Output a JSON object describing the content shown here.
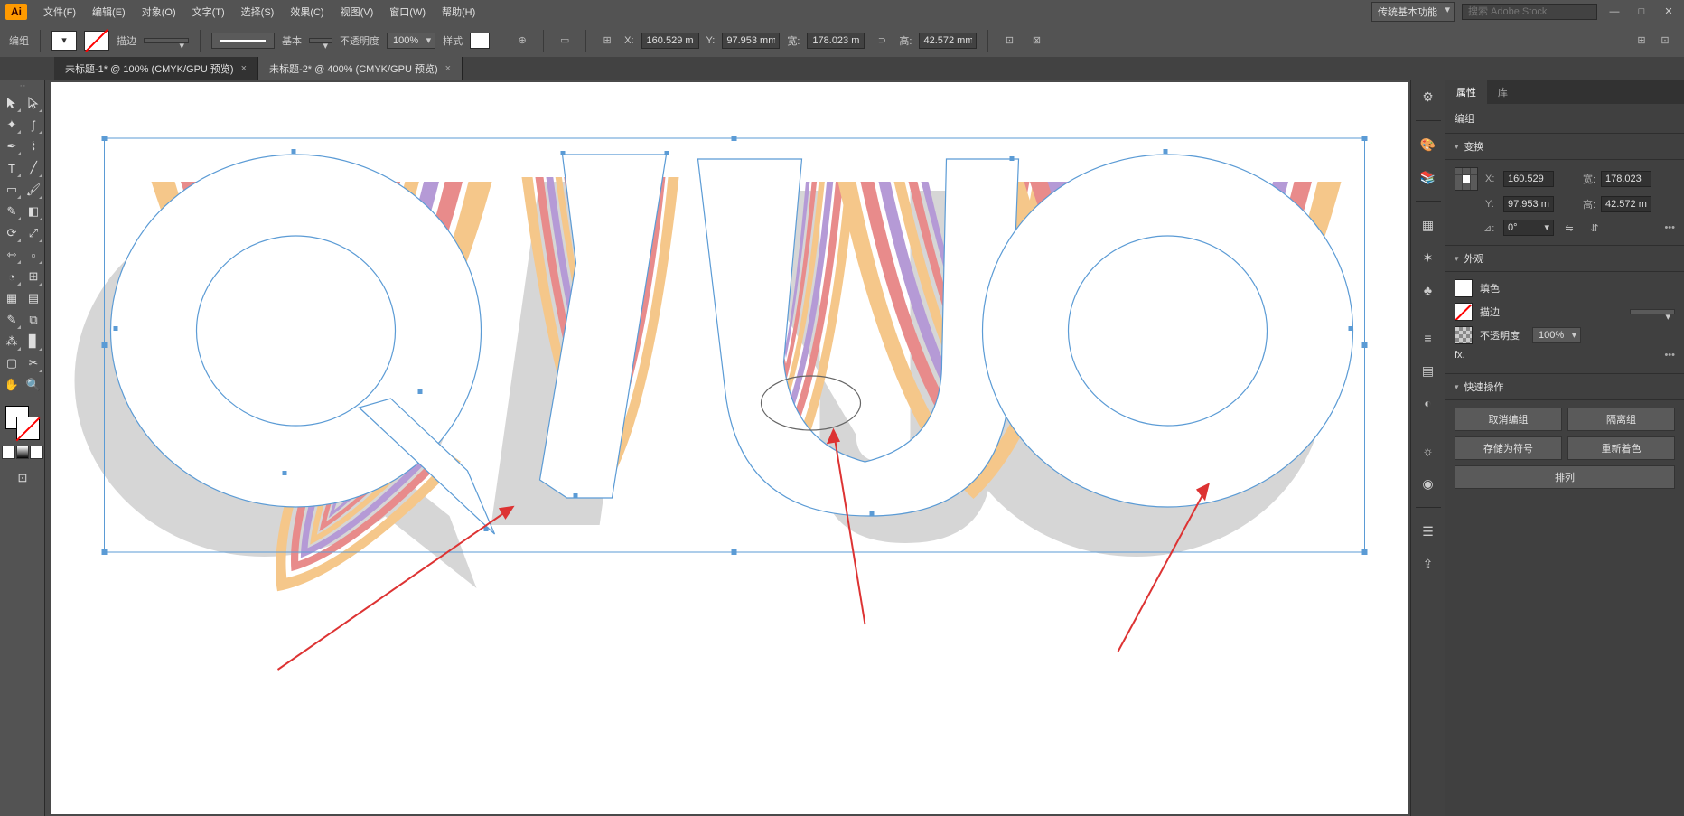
{
  "menubar": {
    "items": [
      "文件(F)",
      "编辑(E)",
      "对象(O)",
      "文字(T)",
      "选择(S)",
      "效果(C)",
      "视图(V)",
      "窗口(W)",
      "帮助(H)"
    ],
    "workspace": "传统基本功能",
    "search_placeholder": "搜索 Adobe Stock"
  },
  "controlbar": {
    "object_type": "编组",
    "stroke_label": "描边",
    "stroke_weight": "",
    "stroke_style_label": "基本",
    "opacity_label": "不透明度",
    "opacity_value": "100%",
    "style_label": "样式",
    "x_label": "X:",
    "x_value": "160.529 m",
    "y_label": "Y:",
    "y_value": "97.953 mm",
    "w_label": "宽:",
    "w_value": "178.023 m",
    "h_label": "高:",
    "h_value": "42.572 mm"
  },
  "tabs": [
    {
      "label": "未标题-1* @ 100% (CMYK/GPU 预览)",
      "active": false
    },
    {
      "label": "未标题-2* @ 400% (CMYK/GPU 预览)",
      "active": true
    }
  ],
  "tools": [
    {
      "name": "selection",
      "glyph": "▲"
    },
    {
      "name": "direct-selection",
      "glyph": "▲"
    },
    {
      "name": "magic-wand",
      "glyph": "✦"
    },
    {
      "name": "lasso",
      "glyph": "ʃ"
    },
    {
      "name": "pen",
      "glyph": "✒"
    },
    {
      "name": "curvature",
      "glyph": "⌇"
    },
    {
      "name": "type",
      "glyph": "T"
    },
    {
      "name": "line-segment",
      "glyph": "╱"
    },
    {
      "name": "rectangle",
      "glyph": "▭"
    },
    {
      "name": "paintbrush",
      "glyph": "🖌"
    },
    {
      "name": "shaper",
      "glyph": "✎"
    },
    {
      "name": "eraser",
      "glyph": "◧"
    },
    {
      "name": "rotate",
      "glyph": "⟳"
    },
    {
      "name": "scale",
      "glyph": "⤢"
    },
    {
      "name": "width",
      "glyph": "⇿"
    },
    {
      "name": "free-transform",
      "glyph": "▭"
    },
    {
      "name": "shape-builder",
      "glyph": "◔"
    },
    {
      "name": "perspective-grid",
      "glyph": "⊞"
    },
    {
      "name": "mesh",
      "glyph": "▦"
    },
    {
      "name": "gradient",
      "glyph": "▤"
    },
    {
      "name": "eyedropper",
      "glyph": "✎"
    },
    {
      "name": "blend",
      "glyph": "⧉"
    },
    {
      "name": "symbol-sprayer",
      "glyph": "⁂"
    },
    {
      "name": "column-graph",
      "glyph": "▊"
    },
    {
      "name": "artboard",
      "glyph": "▢"
    },
    {
      "name": "slice",
      "glyph": "✂"
    },
    {
      "name": "hand",
      "glyph": "✋"
    },
    {
      "name": "zoom",
      "glyph": "🔍"
    }
  ],
  "rail_icons": [
    {
      "name": "properties",
      "glyph": "⚙"
    },
    {
      "name": "color",
      "glyph": "🎨"
    },
    {
      "name": "libraries",
      "glyph": "📚"
    },
    {
      "name": "swatches",
      "glyph": "▦"
    },
    {
      "name": "brushes",
      "glyph": "✶"
    },
    {
      "name": "symbols",
      "glyph": "♣"
    },
    {
      "name": "stroke",
      "glyph": "≡"
    },
    {
      "name": "gradient",
      "glyph": "▤"
    },
    {
      "name": "transparency",
      "glyph": "◐"
    },
    {
      "name": "appearance",
      "glyph": "☼"
    },
    {
      "name": "graphic-styles",
      "glyph": "◉"
    },
    {
      "name": "layers",
      "glyph": "☰"
    },
    {
      "name": "asset-export",
      "glyph": "⇪"
    }
  ],
  "properties": {
    "tabs": [
      "属性",
      "库"
    ],
    "object_type": "编组",
    "transform_title": "变换",
    "x_label": "X:",
    "x_value": "160.529",
    "y_label": "Y:",
    "y_value": "97.953 m",
    "w_label": "宽:",
    "w_value": "178.023",
    "h_label": "高:",
    "h_value": "42.572 m",
    "angle_label": "⊿:",
    "angle_value": "0°",
    "more": "•••",
    "appearance_title": "外观",
    "fill_label": "填色",
    "stroke_label": "描边",
    "opacity_label": "不透明度",
    "opacity_value": "100%",
    "fx_label": "fx.",
    "quick_title": "快速操作",
    "btn_cancel_group": "取消编组",
    "btn_isolate": "隔离组",
    "btn_save_symbol": "存储为符号",
    "btn_recolor": "重新着色",
    "btn_arrange": "排列"
  }
}
